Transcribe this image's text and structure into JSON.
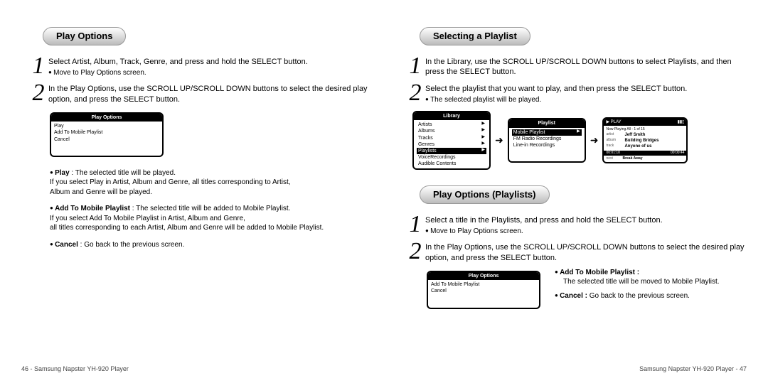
{
  "left": {
    "title": "Play Options",
    "steps": [
      {
        "num": "1",
        "main": "Select Artist, Album, Track, Genre, and press and hold the SELECT button.",
        "sub": "Move to Play Options screen."
      },
      {
        "num": "2",
        "main": "In the Play Options, use the SCROLL UP/SCROLL DOWN buttons to select the desired play option, and press the SELECT button."
      }
    ],
    "device": {
      "title": "Play Options",
      "items": [
        "Play",
        "Add To Mobile Playlist",
        "Cancel"
      ]
    },
    "bullets": [
      {
        "lead": "Play",
        "tail": " : The selected title will be played.",
        "extra": [
          "If you select Play in Artist, Album and Genre, all titles corresponding to Artist,",
          "Album and Genre will be played."
        ]
      },
      {
        "lead": "Add To Mobile Playlist",
        "tail": " : The selected title will be added to Mobile Playlist.",
        "extra": [
          "If you select Add To Mobile Playlist in Artist, Album and Genre,",
          "all titles corresponding to each Artist, Album and Genre will be added to Mobile Playlist."
        ]
      },
      {
        "lead": "Cancel",
        "tail": " : Go back to the previous screen."
      }
    ],
    "footer": "46 - Samsung Napster YH-920 Player"
  },
  "right": {
    "sect1": {
      "title": "Selecting a Playlist",
      "steps": [
        {
          "num": "1",
          "main": "In the Library, use the SCROLL UP/SCROLL DOWN buttons to select Playlists, and then press the SELECT button."
        },
        {
          "num": "2",
          "main": "Select the playlist that you want to play, and then press the SELECT button.",
          "sub": "The selected playlist will be played."
        }
      ],
      "flow": {
        "lib": {
          "title": "Library",
          "items": [
            "Artists",
            "Albums",
            "Tracks",
            "Genres",
            "Playlists",
            "VoiceRecordings",
            "Audible Contents"
          ],
          "selected": "Playlists"
        },
        "pl": {
          "title": "Playlist",
          "items": [
            "Mobile Playlist",
            "FM Radio Recordings",
            "Line-in Recordings"
          ],
          "selected": "Mobile Playlist"
        },
        "np": {
          "playlabel": "▶ PLAY",
          "bars": "▮▮▯",
          "now": "Now Playing All - 1 of 15",
          "artist_l": "artist",
          "artist_v": "Jeff Smith",
          "album_l": "album",
          "album_v": "Building Bridges",
          "track_l": "track",
          "track_v": "Anyone of us",
          "t1": "00:01:10",
          "t2": "00:00:44",
          "next_l": "next",
          "next_v": "Break Away"
        }
      }
    },
    "sect2": {
      "title": "Play Options (Playlists)",
      "steps": [
        {
          "num": "1",
          "main": "Select a title in the Playlists, and press and hold the SELECT button.",
          "sub": "Move to Play Options screen."
        },
        {
          "num": "2",
          "main": "In the Play Options, use the SCROLL UP/SCROLL DOWN buttons to select the desired play option, and press the SELECT button."
        }
      ],
      "device": {
        "title": "Play Options",
        "items": [
          "Add To Mobile Playlist",
          "Cancel"
        ]
      },
      "side": [
        {
          "lead": "Add To Mobile Playlist :",
          "cont": "The selected title will be moved to Mobile Playlist."
        },
        {
          "lead": "Cancel :",
          "tail2": " Go back to the previous screen."
        }
      ]
    },
    "footer": "Samsung Napster YH-920 Player - 47"
  }
}
